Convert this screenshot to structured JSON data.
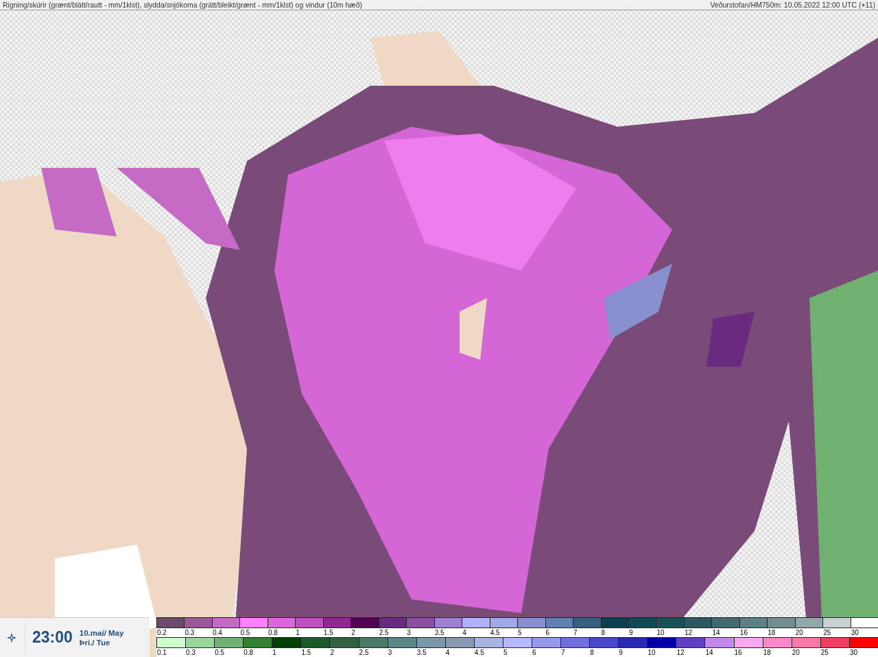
{
  "header": {
    "title": "Rigning/skúrir (grænt/blátt/rautt - mm/1klst), slydda/snjókoma (grátt/bleikt/grænt - mm/1klst) og vindur (10m hæð)",
    "source": "Veðurstofan/HM750m: 10.05.2022 12:00 UTC (+11)"
  },
  "time_panel": {
    "time": "23:00",
    "date": "10.maí/ May",
    "weekday": "Þri./ Tue"
  },
  "legends": [
    {
      "items": [
        {
          "label": "0.2",
          "color": "#6b4a6b"
        },
        {
          "label": "0.3",
          "color": "#9a5a9a"
        },
        {
          "label": "0.4",
          "color": "#c56ac5"
        },
        {
          "label": "0.5",
          "color": "#ff80ff"
        },
        {
          "label": "0.8",
          "color": "#dd66dd"
        },
        {
          "label": "1",
          "color": "#c050c0"
        },
        {
          "label": "1.5",
          "color": "#902890"
        },
        {
          "label": "2",
          "color": "#500050"
        },
        {
          "label": "2.5",
          "color": "#6a2a80"
        },
        {
          "label": "3",
          "color": "#8a50a0"
        },
        {
          "label": "3.5",
          "color": "#a080d0"
        },
        {
          "label": "4",
          "color": "#b0b0ff"
        },
        {
          "label": "4.5",
          "color": "#a0a8e8"
        },
        {
          "label": "5",
          "color": "#8890d0"
        },
        {
          "label": "6",
          "color": "#6080b0"
        },
        {
          "label": "7",
          "color": "#356080"
        },
        {
          "label": "8",
          "color": "#0a4050"
        },
        {
          "label": "9",
          "color": "#104a55"
        },
        {
          "label": "10",
          "color": "#1a5058"
        },
        {
          "label": "12",
          "color": "#2a5a60"
        },
        {
          "label": "14",
          "color": "#406a70"
        },
        {
          "label": "16",
          "color": "#5a8088"
        },
        {
          "label": "18",
          "color": "#709090"
        },
        {
          "label": "20",
          "color": "#90a8a8"
        },
        {
          "label": "25",
          "color": "#c8d0d0"
        },
        {
          "label": "30",
          "color": "#ffffff"
        }
      ]
    },
    {
      "items": [
        {
          "label": "0.1",
          "color": "#ccffcc"
        },
        {
          "label": "0.3",
          "color": "#99d699"
        },
        {
          "label": "0.5",
          "color": "#70b070"
        },
        {
          "label": "0.8",
          "color": "#308030"
        },
        {
          "label": "1",
          "color": "#004000"
        },
        {
          "label": "1.5",
          "color": "#1a5a2a"
        },
        {
          "label": "2",
          "color": "#306040"
        },
        {
          "label": "2.5",
          "color": "#4a7a68"
        },
        {
          "label": "3",
          "color": "#5a8888"
        },
        {
          "label": "3.5",
          "color": "#7a98a8"
        },
        {
          "label": "4",
          "color": "#8898b0"
        },
        {
          "label": "4.5",
          "color": "#a8b4e0"
        },
        {
          "label": "5",
          "color": "#b8b8ff"
        },
        {
          "label": "6",
          "color": "#9898e8"
        },
        {
          "label": "7",
          "color": "#7070d8"
        },
        {
          "label": "8",
          "color": "#4848c8"
        },
        {
          "label": "9",
          "color": "#2828b0"
        },
        {
          "label": "10",
          "color": "#0000a8"
        },
        {
          "label": "12",
          "color": "#6040c0"
        },
        {
          "label": "14",
          "color": "#c088e8"
        },
        {
          "label": "16",
          "color": "#f8a8f0"
        },
        {
          "label": "18",
          "color": "#f888c8"
        },
        {
          "label": "20",
          "color": "#f878a8"
        },
        {
          "label": "25",
          "color": "#f04060"
        },
        {
          "label": "30",
          "color": "#ff0000"
        }
      ]
    }
  ]
}
